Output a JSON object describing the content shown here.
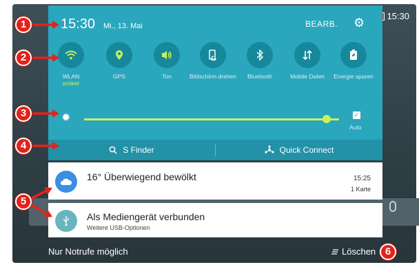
{
  "status_bar": {
    "time": "15:30",
    "battery_percent": "%"
  },
  "panel": {
    "time": "15:30",
    "date": "Mi., 13. Mai",
    "edit_label": "BEARB.",
    "toggles": [
      {
        "label": "WLAN",
        "sub": "smiker",
        "icon": "wifi-icon",
        "active": true
      },
      {
        "label": "GPS",
        "sub": "",
        "icon": "location-icon",
        "active": true
      },
      {
        "label": "Ton",
        "sub": "",
        "icon": "sound-icon",
        "active": true
      },
      {
        "label": "Bildschirm drehen",
        "sub": "",
        "icon": "rotate-icon",
        "active": false
      },
      {
        "label": "Bluetooth",
        "sub": "",
        "icon": "bluetooth-icon",
        "active": false
      },
      {
        "label": "Mobile Daten",
        "sub": "",
        "icon": "mobile-data-icon",
        "active": false
      },
      {
        "label": "Energie sparen",
        "sub": "",
        "icon": "battery-saver-icon",
        "active": false
      }
    ],
    "brightness": {
      "level": 0.95,
      "auto_label": "Auto",
      "auto_checked": true
    },
    "s_finder": "S Finder",
    "quick_connect": "Quick Connect"
  },
  "notifications": [
    {
      "title": "16° Überwiegend bewölkt",
      "time": "15:25",
      "count": "1 Karte",
      "icon": "cloud-icon"
    },
    {
      "title": "Als Mediengerät verbunden",
      "subtitle": "Weitere USB-Optionen",
      "icon": "usb-icon"
    }
  ],
  "footer": {
    "left": "Nur Notrufe möglich",
    "clear": "Löschen"
  },
  "markers": [
    "1",
    "2",
    "3",
    "4",
    "5",
    "6"
  ],
  "colors": {
    "panel": "#2aa6bd",
    "accent": "#c9f15a",
    "marker": "#e2231a"
  }
}
